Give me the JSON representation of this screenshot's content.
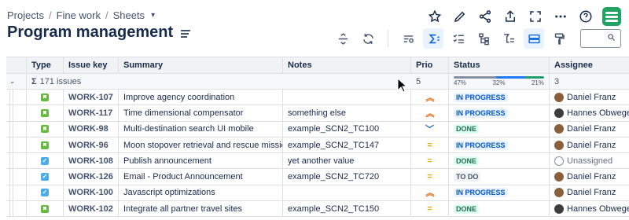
{
  "breadcrumb": {
    "projects": "Projects",
    "sep": "/",
    "project": "Fine work",
    "section": "Sheets"
  },
  "page": {
    "title": "Program management"
  },
  "top_actions": [
    "star-icon",
    "pencil-icon",
    "share-icon",
    "export-icon",
    "fullscreen-icon",
    "more-icon",
    "help-icon"
  ],
  "toolbar": {
    "search_placeholder": ""
  },
  "columns": [
    "Type",
    "Issue key",
    "Summary",
    "Notes",
    "Prio",
    "Status",
    "Assignee"
  ],
  "summary": {
    "sigma": "Σ",
    "issues": "171 issues",
    "prio": "5",
    "status_pct": [
      "47%",
      "32%",
      "21%"
    ],
    "status_fractions": [
      0.47,
      0.32,
      0.21
    ],
    "status_colors": [
      "#8590a2",
      "#1d7afc",
      "#22a06b"
    ],
    "assignee": "3"
  },
  "rows": [
    {
      "type": "story",
      "key": "WORK-107",
      "summary": "Improve agency coordination",
      "notes": "",
      "prio": "high",
      "status": "IN PROGRESS",
      "status_kind": "progress",
      "assignee": "Daniel Franz",
      "avatar": "brown"
    },
    {
      "type": "story",
      "key": "WORK-117",
      "summary": "Time dimensional compensator",
      "notes": "something else",
      "prio": "high",
      "status": "IN PROGRESS",
      "status_kind": "progress",
      "assignee": "Hannes Obwege",
      "avatar": "dark"
    },
    {
      "type": "story",
      "key": "WORK-98",
      "summary": "Multi-destination search UI mobile",
      "notes": "example_SCN2_TC100",
      "prio": "low",
      "status": "DONE",
      "status_kind": "done",
      "assignee": "Daniel Franz",
      "avatar": "brown"
    },
    {
      "type": "story",
      "key": "WORK-96",
      "summary": "Moon stopover retrieval and rescue missio...",
      "notes": "example_SCN2_TC147",
      "prio": "medium",
      "status": "IN PROGRESS",
      "status_kind": "progress",
      "assignee": "Daniel Franz",
      "avatar": "brown"
    },
    {
      "type": "task",
      "key": "WORK-108",
      "summary": "Publish announcement",
      "notes": "yet another value",
      "prio": "medium",
      "status": "DONE",
      "status_kind": "done",
      "assignee": "Unassigned",
      "avatar": "empty"
    },
    {
      "type": "task",
      "key": "WORK-126",
      "summary": "Email - Product Announcement",
      "notes": "example_SCN2_TC720",
      "prio": "medium",
      "status": "TO DO",
      "status_kind": "todo",
      "assignee": "Daniel Franz",
      "avatar": "brown"
    },
    {
      "type": "task",
      "key": "WORK-100",
      "summary": "Javascript optimizations",
      "notes": "",
      "prio": "high",
      "status": "IN PROGRESS",
      "status_kind": "progress",
      "assignee": "Daniel Franz",
      "avatar": "brown"
    },
    {
      "type": "story",
      "key": "WORK-102",
      "summary": "Integrate all partner travel sites",
      "notes": "example_SCN2_TC150",
      "prio": "medium",
      "status": "DONE",
      "status_kind": "done",
      "assignee": "Hannes Obwege",
      "avatar": "dark"
    }
  ],
  "glyphs": {
    "prio_high": "︽",
    "prio_medium": "=",
    "prio_low": "﹀",
    "task_check": "✓"
  }
}
